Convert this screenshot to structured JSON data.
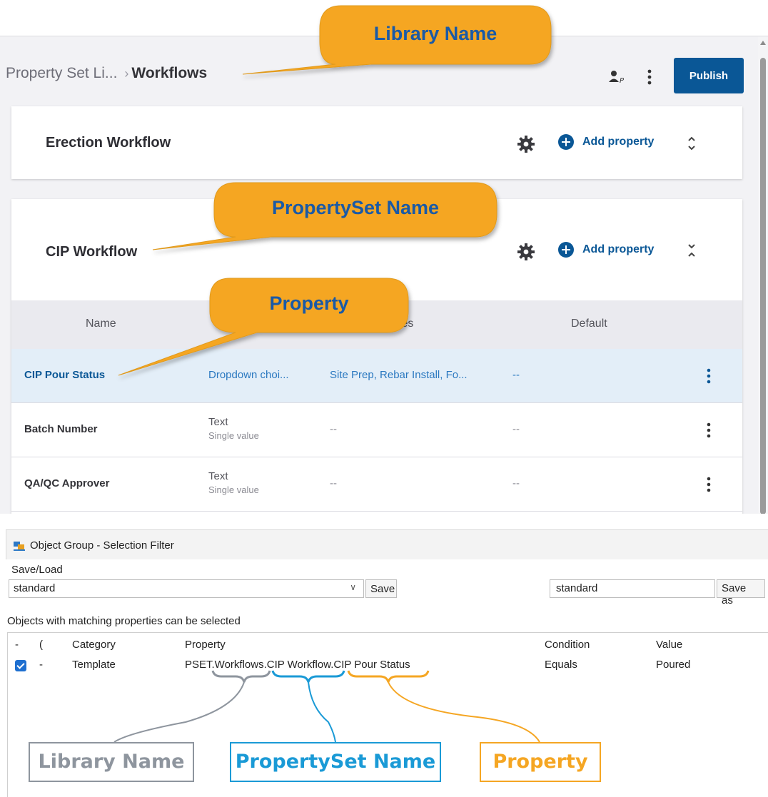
{
  "top": {
    "breadcrumb": {
      "parent": "Property Set Li...",
      "separator": "›",
      "current": "Workflows"
    },
    "publish_label": "Publish",
    "cards": [
      {
        "title": "Erection Workflow",
        "add_property_label": "Add property"
      },
      {
        "title": "CIP Workflow",
        "add_property_label": "Add property"
      }
    ],
    "table": {
      "headers": {
        "name": "Name",
        "values": "lues",
        "default": "Default"
      },
      "rows": [
        {
          "name": "CIP Pour Status",
          "type": "Dropdown choi...",
          "type_sub": "",
          "values": "Site Prep, Rebar Install, Fo...",
          "default": "--",
          "selected": true
        },
        {
          "name": "Batch Number",
          "type": "Text",
          "type_sub": "Single value",
          "values": "--",
          "default": "--",
          "selected": false
        },
        {
          "name": "QA/QC Approver",
          "type": "Text",
          "type_sub": "Single value",
          "values": "--",
          "default": "--",
          "selected": false
        }
      ]
    },
    "callouts": {
      "library_name": "Library Name",
      "propertyset_name": "PropertySet Name",
      "property": "Property"
    }
  },
  "bottom": {
    "window_title": "Object Group - Selection Filter",
    "saveload_label": "Save/Load",
    "combo_value": "standard",
    "save_label": "Save",
    "name_field_value": "standard",
    "save_as_label": "Save as",
    "matching_label": "Objects with matching properties can be selected",
    "columns": {
      "dash": "-",
      "paren": "(",
      "category": "Category",
      "property": "Property",
      "condition": "Condition",
      "value": "Value"
    },
    "row": {
      "dash": "-",
      "category": "Template",
      "property": "PSET.Workflows.CIP Workflow.CIP Pour Status",
      "condition": "Equals",
      "value": "Poured"
    },
    "labels": {
      "library_name": "Library Name",
      "propertyset_name": "PropertySet Name",
      "property": "Property"
    }
  },
  "colors": {
    "brand_blue": "#0a5796",
    "callout_orange": "#f5a623",
    "label_grey": "#8e959e",
    "label_blue": "#1a9ad6",
    "label_orange": "#f5a623"
  }
}
